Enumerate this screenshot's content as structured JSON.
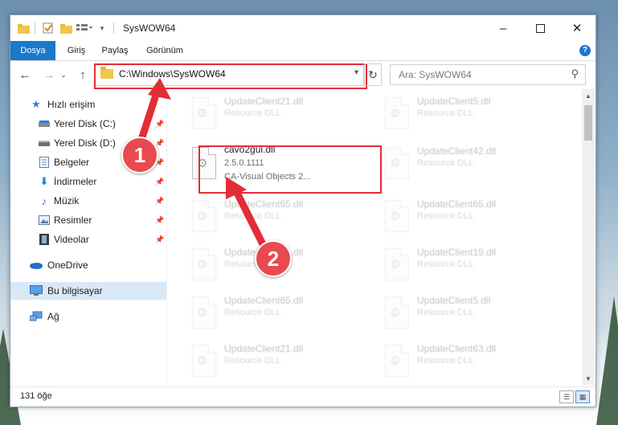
{
  "window": {
    "title": "SysWOW64"
  },
  "ribbon": {
    "tabs": [
      "Dosya",
      "Giriş",
      "Paylaş",
      "Görünüm"
    ],
    "active_tab": "Dosya",
    "help": "?"
  },
  "nav": {
    "address": "C:\\Windows\\SysWOW64",
    "search_placeholder": "Ara: SysWOW64"
  },
  "sidebar": {
    "items": [
      {
        "label": "Hızlı erişim",
        "icon": "star-icon",
        "pinned": false
      },
      {
        "label": "Yerel Disk (C:)",
        "icon": "drive-icon",
        "pinned": true
      },
      {
        "label": "Yerel Disk (D:)",
        "icon": "drive-icon",
        "pinned": true
      },
      {
        "label": "Belgeler",
        "icon": "document-icon",
        "pinned": true
      },
      {
        "label": "İndirmeler",
        "icon": "download-icon",
        "pinned": true
      },
      {
        "label": "Müzik",
        "icon": "music-icon",
        "pinned": true
      },
      {
        "label": "Resimler",
        "icon": "pictures-icon",
        "pinned": true
      },
      {
        "label": "Videolar",
        "icon": "video-icon",
        "pinned": true
      },
      {
        "label": "OneDrive",
        "icon": "cloud-icon",
        "pinned": false
      },
      {
        "label": "Bu bilgisayar",
        "icon": "computer-icon",
        "pinned": false,
        "selected": true
      },
      {
        "label": "Ağ",
        "icon": "network-icon",
        "pinned": false
      }
    ]
  },
  "files": {
    "left": [
      {
        "name": "UpdateClient21.dll",
        "desc": "Resource DLL"
      },
      {
        "name": "cavo2gui.dll",
        "version": "2.5.0.1111",
        "desc": "CA-Visual Objects 2...",
        "highlighted": true
      },
      {
        "name": "UpdateClient65.dll",
        "desc": "Resource DLL"
      },
      {
        "name": "UpdateClient21.dll",
        "desc": "Resource DLL"
      },
      {
        "name": "UpdateClient65.dll",
        "desc": "Resource DLL"
      },
      {
        "name": "UpdateClient21.dll",
        "desc": "Resource DLL"
      }
    ],
    "right": [
      {
        "name": "UpdateClient5.dll",
        "desc": "Resource DLL"
      },
      {
        "name": "UpdateClient42.dll",
        "desc": "Resource DLL"
      },
      {
        "name": "UpdateClient65.dll",
        "desc": "Resource DLL"
      },
      {
        "name": "UpdateClient19.dll",
        "desc": "Resource DLL"
      },
      {
        "name": "UpdateClient5.dll",
        "desc": "Resource DLL"
      },
      {
        "name": "UpdateClient63.dll",
        "desc": "Resource DLL"
      }
    ]
  },
  "status": {
    "count": "131 öğe"
  },
  "annotations": {
    "step1": "1",
    "step2": "2",
    "color": "#e32d36"
  }
}
